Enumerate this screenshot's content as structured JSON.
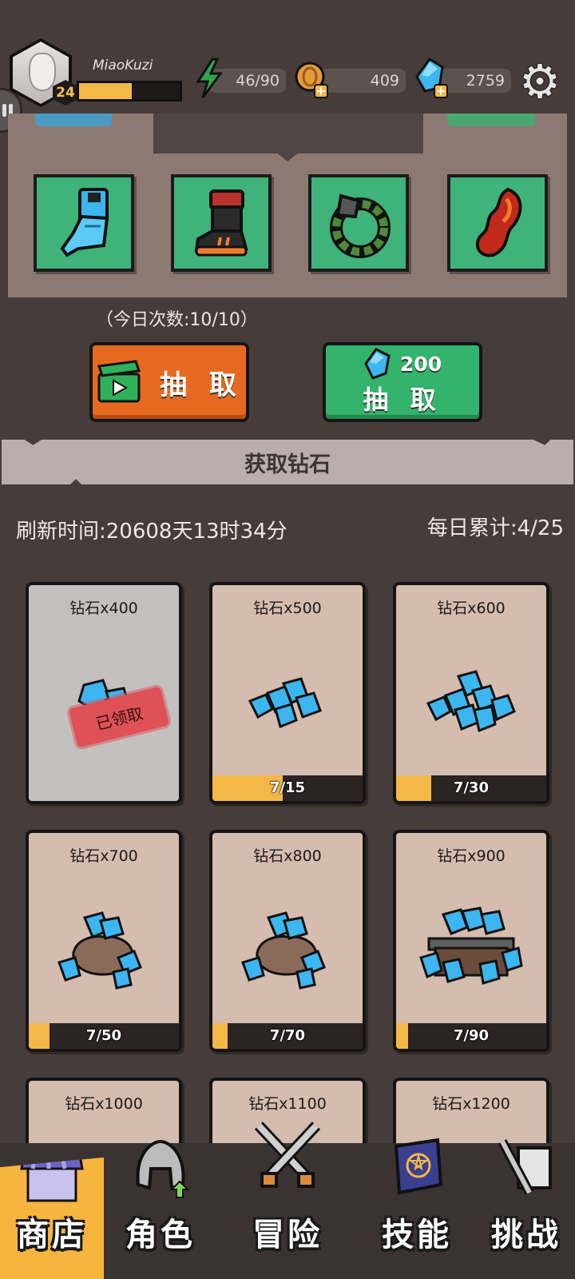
{
  "player": {
    "name": "MiaoKuzi",
    "level": "24",
    "xp_fraction": 0.52
  },
  "resources": {
    "energy": "46/90",
    "coins": "409",
    "diamonds": "2759"
  },
  "equipment": {
    "slots": [
      {
        "icon": "blue-gauntlet-icon"
      },
      {
        "icon": "lava-boot-icon"
      },
      {
        "icon": "vine-ring-icon"
      },
      {
        "icon": "flame-charm-icon"
      }
    ]
  },
  "draw": {
    "daily_count": "（今日次数:10/10）",
    "ad_draw_label": "抽 取",
    "diamond_draw_cost": "200",
    "diamond_draw_label": "抽 取"
  },
  "section": {
    "title": "获取钻石"
  },
  "refresh": {
    "text": "刷新时间:20608天13时34分",
    "daily_total": "每日累计:4/25"
  },
  "cards": [
    {
      "title": "钻石x400",
      "progress_text": "",
      "progress": 1.0,
      "claimed": true,
      "claimed_label": "已领取",
      "art": "diamond-small-pile-icon"
    },
    {
      "title": "钻石x500",
      "progress_text": "7/15",
      "progress": 0.4667,
      "claimed": false,
      "art": "diamond-pile-icon"
    },
    {
      "title": "钻石x600",
      "progress_text": "7/30",
      "progress": 0.2333,
      "claimed": false,
      "art": "diamond-large-pile-icon"
    },
    {
      "title": "钻石x700",
      "progress_text": "7/50",
      "progress": 0.14,
      "claimed": false,
      "art": "diamond-sack-icon"
    },
    {
      "title": "钻石x800",
      "progress_text": "7/70",
      "progress": 0.1,
      "claimed": false,
      "art": "diamond-sack-icon"
    },
    {
      "title": "钻石x900",
      "progress_text": "7/90",
      "progress": 0.0778,
      "claimed": false,
      "art": "diamond-minecart-icon"
    },
    {
      "title": "钻石x1000"
    },
    {
      "title": "钻石x1100"
    },
    {
      "title": "钻石x1200"
    }
  ],
  "nav": {
    "shop": "商店",
    "character": "角色",
    "adventure": "冒险",
    "skills": "技能",
    "challenge": "挑战"
  },
  "colors": {
    "background": "#463c3a",
    "accent_gold": "#f3b848",
    "diamond_blue": "#3db5ef",
    "slot_green": "#3fb37a",
    "draw_orange": "#e56a1f",
    "draw_green": "#33b36b",
    "claimed_red": "#dd5157"
  }
}
